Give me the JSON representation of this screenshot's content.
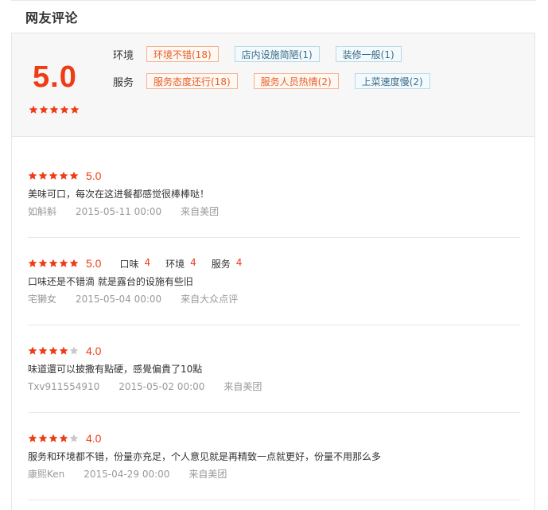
{
  "section": {
    "title": "网友评论"
  },
  "summary": {
    "score": "5.0",
    "stars": 5,
    "tag_groups": [
      {
        "category": "环境",
        "tags": [
          {
            "label": "环境不错(18)",
            "tone": "warm"
          },
          {
            "label": "店内设施简陋(1)",
            "tone": "cool"
          },
          {
            "label": "装修一般(1)",
            "tone": "cool"
          }
        ]
      },
      {
        "category": "服务",
        "tags": [
          {
            "label": "服务态度还行(18)",
            "tone": "warm"
          },
          {
            "label": "服务人员热情(2)",
            "tone": "warm"
          },
          {
            "label": "上菜速度慢(2)",
            "tone": "cool"
          }
        ]
      }
    ]
  },
  "colors": {
    "accent": "#ee3c14",
    "star_on": "#ee3c14",
    "star_off": "#c8c8c8"
  },
  "reviews": [
    {
      "stars": 5,
      "score": "5.0",
      "text": "美味可口，每次在这进餐都感觉很棒棒哒！",
      "user": "如斛斛",
      "date": "2015-05-11 00:00",
      "source": "来自美团"
    },
    {
      "stars": 5,
      "score": "5.0",
      "sub_scores": [
        {
          "label": "口味",
          "value": "4"
        },
        {
          "label": "环境",
          "value": "4"
        },
        {
          "label": "服务",
          "value": "4"
        }
      ],
      "text": "口味还是不错滴 就是露台的设施有些旧",
      "user": "宅獭女",
      "date": "2015-05-04 00:00",
      "source": "来自大众点评"
    },
    {
      "stars": 4,
      "score": "4.0",
      "text": "味道還可以披撒有點硬，感覺偏貴了10點",
      "user": "Txv911554910",
      "date": "2015-05-02 00:00",
      "source": "来自美团"
    },
    {
      "stars": 4,
      "score": "4.0",
      "text": "服务和环境都不错，份量亦充足，个人意见就是再精致一点就更好，份量不用那么多",
      "user": "康熙Ken",
      "date": "2015-04-29 00:00",
      "source": "来自美团"
    }
  ]
}
